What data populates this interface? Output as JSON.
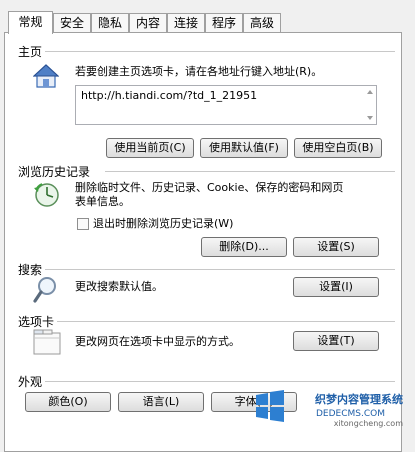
{
  "tabs": [
    "常规",
    "安全",
    "隐私",
    "内容",
    "连接",
    "程序",
    "高级"
  ],
  "home": {
    "title": "主页",
    "desc": "若要创建主页选项卡，请在各地址行键入地址(R)。",
    "url": "http://h.tiandi.com/?td_1_21951",
    "btn_current": "使用当前页(C)",
    "btn_default": "使用默认值(F)",
    "btn_blank": "使用空白页(B)"
  },
  "history": {
    "title": "浏览历史记录",
    "desc1": "删除临时文件、历史记录、Cookie、保存的密码和网页",
    "desc2": "表单信息。",
    "checkbox_label": "退出时删除浏览历史记录(W)",
    "btn_delete": "删除(D)...",
    "btn_settings": "设置(S)"
  },
  "search": {
    "title": "搜索",
    "desc": "更改搜索默认值。",
    "btn_settings": "设置(I)"
  },
  "tabs_section": {
    "title": "选项卡",
    "desc": "更改网页在选项卡中显示的方式。",
    "btn_settings": "设置(T)"
  },
  "appearance": {
    "title": "外观",
    "btn_colors": "颜色(O)",
    "btn_languages": "语言(L)",
    "btn_fonts": "字体(N)"
  },
  "watermark": {
    "line1": "织梦内容管理系统",
    "line2": "DEDECMS.COM",
    "line3": "xitongcheng.com"
  }
}
